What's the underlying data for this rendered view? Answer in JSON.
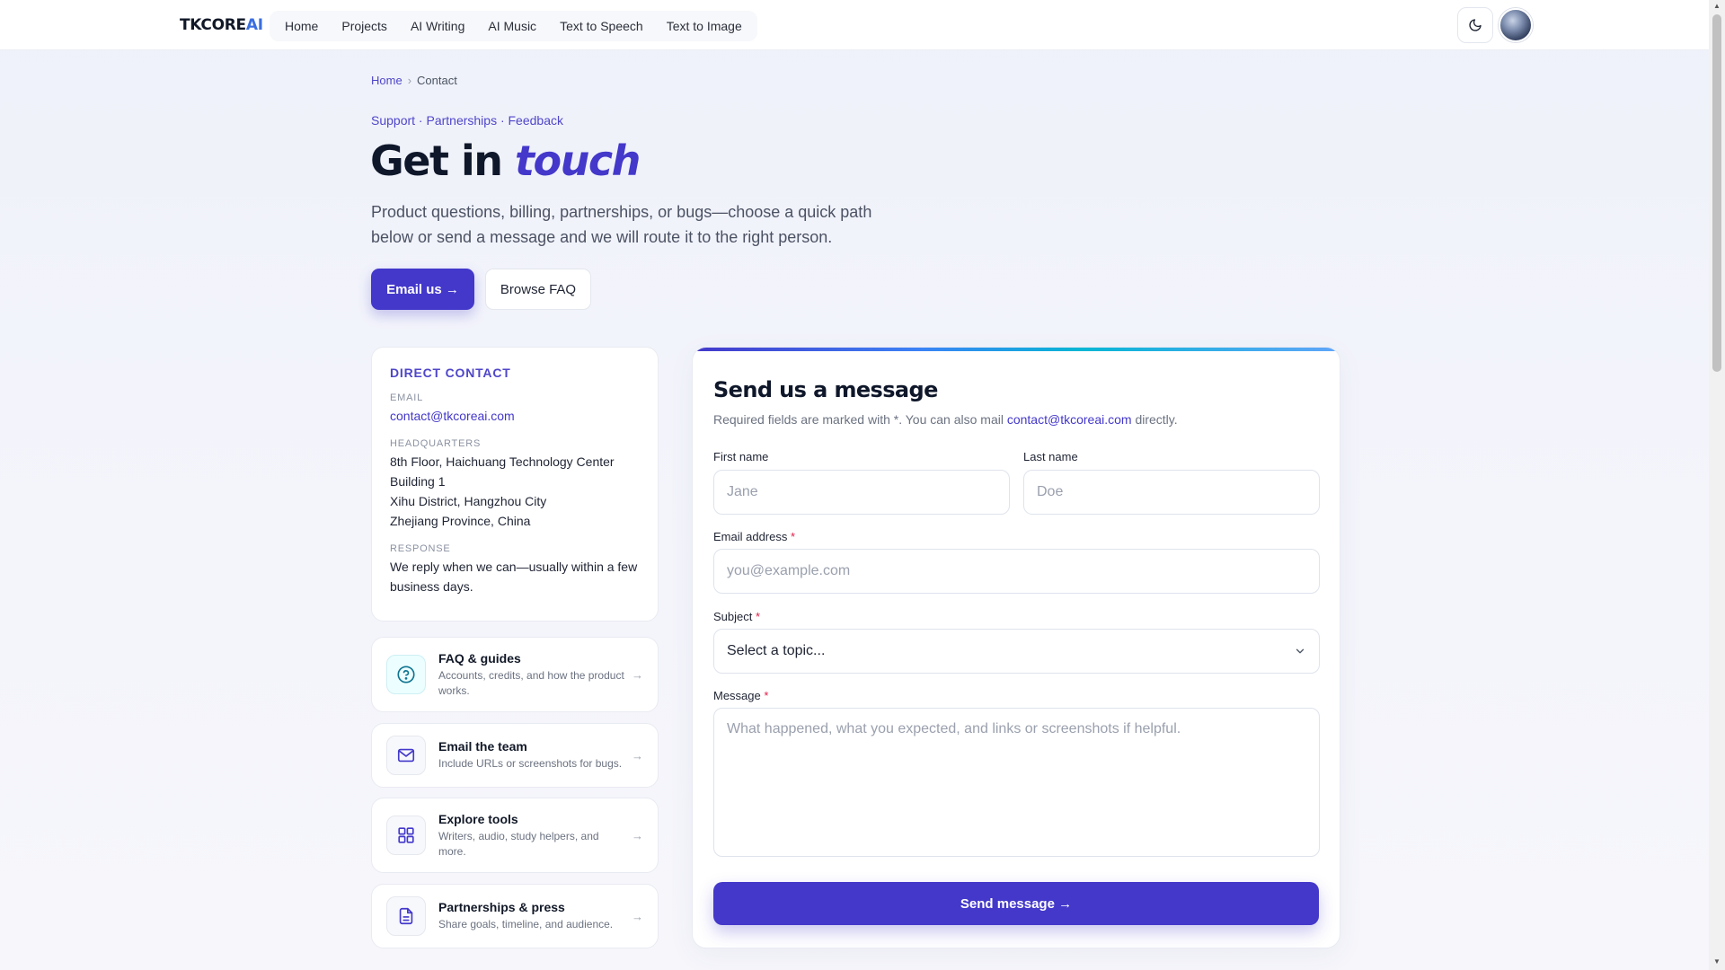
{
  "brand": {
    "name_main": "TKCORE",
    "name_accent": "AI"
  },
  "nav": {
    "items": [
      "Home",
      "Projects",
      "AI Writing",
      "AI Music",
      "Text to Speech",
      "Text to Image"
    ]
  },
  "header": {
    "theme_icon": "moon-icon",
    "avatar_icon": "avatar"
  },
  "breadcrumb": {
    "home": "Home",
    "separator": "›",
    "current": "Contact"
  },
  "hero": {
    "eyebrow": "Support · Partnerships · Feedback",
    "title_plain": "Get in ",
    "title_accent": "touch",
    "lead": "Product questions, billing, partnerships, or bugs—choose a quick path below or send a message and we will route it to the right person.",
    "primary_button": "Email us →",
    "secondary_button": "Browse FAQ"
  },
  "direct_contact": {
    "heading": "DIRECT CONTACT",
    "email_label": "EMAIL",
    "email": "contact@tkcoreai.com",
    "hq_label": "HEADQUARTERS",
    "hq_lines": [
      "8th Floor, Haichuang Technology Center",
      "Building 1",
      "Xihu District, Hangzhou City",
      "Zhejiang Province, China"
    ],
    "response_label": "RESPONSE",
    "response": "We reply when we can—usually within a few business days."
  },
  "quick_links": [
    {
      "title": "FAQ & guides",
      "desc": "Accounts, credits, and how the product works.",
      "icon": "question-circle-icon",
      "arrow": "→"
    },
    {
      "title": "Email the team",
      "desc": "Include URLs or screenshots for bugs.",
      "icon": "mail-icon",
      "arrow": "→"
    },
    {
      "title": "Explore tools",
      "desc": "Writers, audio, study helpers, and more.",
      "icon": "grid-icon",
      "arrow": "→"
    },
    {
      "title": "Partnerships & press",
      "desc": "Share goals, timeline, and audience.",
      "icon": "document-icon",
      "arrow": "→"
    }
  ],
  "form": {
    "title": "Send us a message",
    "sub_before": "Required fields are marked with *. You can also mail ",
    "sub_link": "contact@tkcoreai.com",
    "sub_after": " directly.",
    "first_name_label": "First name",
    "first_name_placeholder": "Jane",
    "last_name_label": "Last name",
    "last_name_placeholder": "Doe",
    "email_label": "Email address",
    "email_placeholder": "you@example.com",
    "subject_label": "Subject",
    "subject_value": "Select a topic...",
    "message_label": "Message",
    "message_placeholder": "What happened, what you expected, and links or screenshots if helpful.",
    "required_mark": "*",
    "send_button": "Send message  →"
  },
  "colors": {
    "accent": "#4338ca",
    "brand_ai": "#3b6fe0",
    "required": "#e11d48"
  }
}
